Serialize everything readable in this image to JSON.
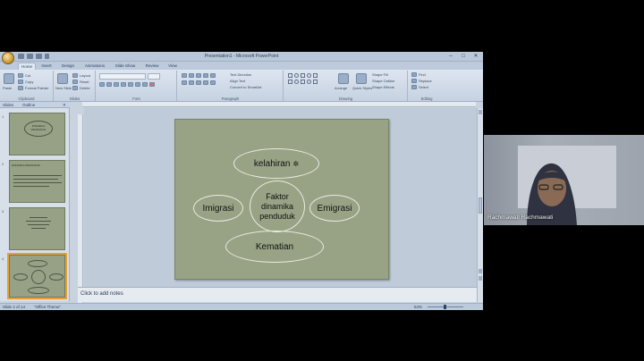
{
  "window": {
    "title": "Presentation1 - Microsoft PowerPoint",
    "controls": [
      "–",
      "□",
      "✕"
    ]
  },
  "ribbon": {
    "tabs": [
      "Home",
      "Insert",
      "Design",
      "Animations",
      "Slide Show",
      "Review",
      "View"
    ],
    "active_tab": "Home",
    "clipboard": {
      "paste": "Paste",
      "cut": "Cut",
      "copy": "Copy",
      "format_painter": "Format Painter",
      "label": "Clipboard"
    },
    "slides": {
      "new_slide": "New Slide",
      "layout": "Layout",
      "reset": "Reset",
      "delete": "Delete",
      "label": "Slides"
    },
    "font": {
      "label": "Font"
    },
    "paragraph": {
      "text_direction": "Text Direction",
      "align_text": "Align Text",
      "convert": "Convert to SmartArt",
      "label": "Paragraph"
    },
    "drawing": {
      "arrange": "Arrange",
      "quick_styles": "Quick Styles",
      "shape_fill": "Shape Fill",
      "shape_outline": "Shape Outline",
      "shape_effects": "Shape Effects",
      "label": "Drawing"
    },
    "editing": {
      "find": "Find",
      "replace": "Replace",
      "select": "Select",
      "label": "Editing"
    }
  },
  "pane": {
    "tabs": [
      "Slides",
      "Outline"
    ],
    "thumbnails": [
      {
        "num": "1",
        "title": "DINAMIKA PENDUDUK"
      },
      {
        "num": "2",
        "title": "DINAMIKA PENDUDUK"
      },
      {
        "num": "3",
        "title": ""
      },
      {
        "num": "4",
        "title": ""
      }
    ]
  },
  "slide": {
    "top": "kelahiran",
    "center": "Faktor dinamika penduduk",
    "left": "Imigrasi",
    "right": "Emigrasi",
    "bottom": "Kematian"
  },
  "notes": {
    "placeholder": "Click to add notes"
  },
  "status": {
    "slide": "Slide 4 of 14",
    "theme": "\"Office Theme\"",
    "zoom": "64%"
  },
  "video": {
    "participant": "Rachmawati Rachmawati"
  }
}
